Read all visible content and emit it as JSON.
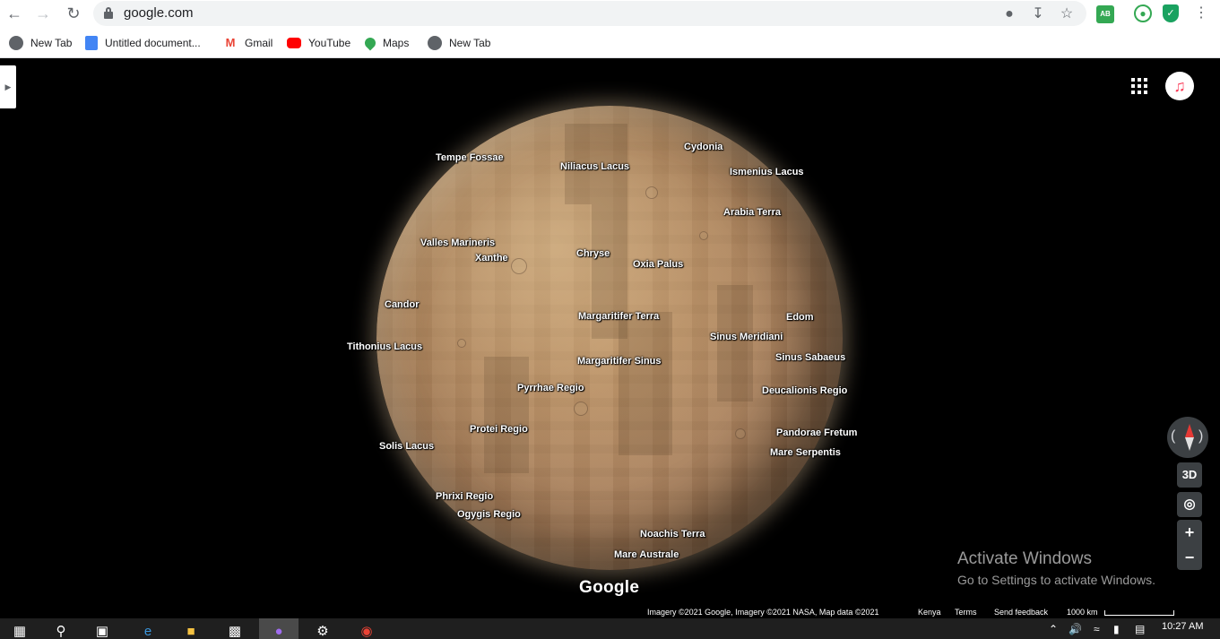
{
  "browser": {
    "url": "google.com",
    "bookmarks": [
      {
        "label": "New Tab",
        "icon": "globe-icon",
        "color": "#5f6368"
      },
      {
        "label": "Untitled document...",
        "icon": "docs-icon",
        "color": "#4285f4"
      },
      {
        "label": "Gmail",
        "icon": "gmail-icon",
        "color": "#ea4335"
      },
      {
        "label": "YouTube",
        "icon": "youtube-icon",
        "color": "#ff0000"
      },
      {
        "label": "Maps",
        "icon": "maps-icon",
        "color": "#34a853"
      },
      {
        "label": "New Tab",
        "icon": "globe-icon",
        "color": "#5f6368"
      }
    ]
  },
  "map": {
    "places": [
      "Tempe Fossae",
      "Niliacus Lacus",
      "Cydonia",
      "Ismenius Lacus",
      "Arabia Terra",
      "Valles Marineris",
      "Xanthe",
      "Chryse",
      "Oxia Palus",
      "Candor",
      "Margaritifer Terra",
      "Edom",
      "Tithonius Lacus",
      "Sinus Meridiani",
      "Sinus Sabaeus",
      "Margaritifer Sinus",
      "Pyrrhae Regio",
      "Deucalionis Regio",
      "Protei Regio",
      "Pandorae Fretum",
      "Solis Lacus",
      "Mare Serpentis",
      "Phrixi Regio",
      "Ogygis Regio",
      "Noachis Terra",
      "Mare Australe"
    ],
    "logo": "Google",
    "controls": {
      "view_3d": "3D",
      "zoom_in": "+",
      "zoom_out": "−"
    },
    "attribution": {
      "imagery": "Imagery ©2021 Google, Imagery ©2021 NASA, Map data ©2021",
      "region": "Kenya",
      "terms": "Terms",
      "feedback": "Send feedback",
      "scale": "1000 km"
    }
  },
  "watermark": {
    "title": "Activate Windows",
    "subtitle": "Go to Settings to activate Windows."
  },
  "taskbar": {
    "time": "10:27 AM"
  }
}
